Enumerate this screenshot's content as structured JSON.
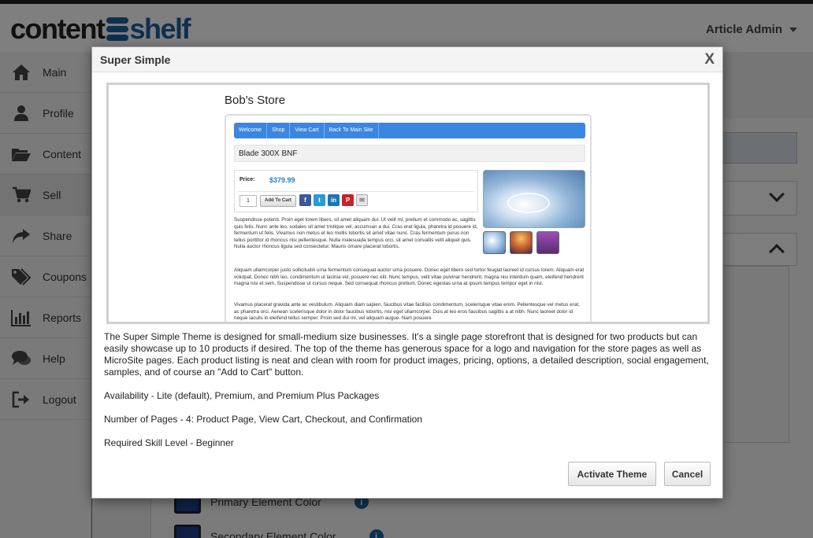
{
  "app": {
    "logo_part1": "content",
    "logo_part2": "shelf",
    "user_menu": "Article Admin"
  },
  "sidebar": {
    "items": [
      {
        "label": "Main",
        "icon": "home-icon"
      },
      {
        "label": "Profile",
        "icon": "user-icon"
      },
      {
        "label": "Content",
        "icon": "folder-icon"
      },
      {
        "label": "Sell",
        "icon": "cart-icon"
      },
      {
        "label": "Share",
        "icon": "share-icon"
      },
      {
        "label": "Coupons",
        "icon": "tags-icon"
      },
      {
        "label": "Reports",
        "icon": "bar-chart-icon"
      },
      {
        "label": "Help",
        "icon": "chat-icon"
      },
      {
        "label": "Logout",
        "icon": "logout-icon"
      }
    ]
  },
  "background": {
    "color_rows": [
      {
        "label": "Primary Element Color"
      },
      {
        "label": "Secondary Element Color"
      }
    ]
  },
  "modal": {
    "title": "Super Simple",
    "close": "X",
    "preview": {
      "store_title": "Bob's Store",
      "nav": [
        "Welcome",
        "Shop",
        "View Cart",
        "Back To Main Site"
      ],
      "product_name": "Blade 300X BNF",
      "price_label": "Price:",
      "price": "$379.99",
      "quantity": "1",
      "add_to_cart": "Add To Cart",
      "social": [
        "f",
        "t",
        "in",
        "P",
        "✉"
      ],
      "paragraphs": [
        "Suspendisse potenti. Proin eget lorem libero, sit amet aliquam dui. Ut velit mi, pretium et commodo ac, sagittis quis felis. Nunc ante leo, sodales sit amet tristique vel, accumsan a dui. Cras erat ligula, pharetra id posuere id, fermentum ut felis. Vivamus non metus et leo mollis lobortis sit amet vitae nunc. Cras fermentum purus non tellus porttitor id rhoncus nisi pellentesque. Nulla malesuada tempus orci, sit amet convallis velit aliquet quis. Nulla auctor rhoncus ligula sed consectetur. Mauris ornare placerat lobortis.",
        "Aliquam ullamcorper justo sollicitudin urna fermentum consequat auctor urna posuere. Donec eget libero sed tortor feugiat laoreet id cursus lorem. Aliquam erat volutpat. Donec nibh leo, condimentum ut lacinia vel, posuere nec elit. Nunc tempus, velit vitae pulvinar hendrerit, magna nisi interdum quam, eleifend hendrerit magna nisi et sem. Suspendisse ut cursus neque. Sed consequat rhoncus pretium. Donec egestas urna at ipsum tempus tempor eget in nisl.",
        "Vivamus placerat gravida ante ac vestibulum. Aliquam diam sapien, faucibus vitae facilisis condimentum, scelerisque vitae enim. Pellentesque vel metus erat, ac pharetra orci. Aenean scelerisque dolor in dolor faucibus lobortis, nisi eget ullamcorper. Duis at leo eros faucibus sagittis a at nibh. Nunc laoreet dolor id neque iaculis in eleifend tellus semper. Proin sed dui mi, vel aliquam augue. Nam posuere"
      ]
    },
    "description": "The Super Simple Theme is designed for small-medium size businesses. It's a single page storefront that is designed for two products but can easily showcase up to 10 products if desired. The top of the theme has generous space for a logo and navigation for the store pages as well as MicroSite pages. Each product listing is neat and clean with room for product images, pricing, options, a detailed description, social engagement, samples, and of course an \"Add to Cart\" button.",
    "availability": "Availability - Lite (default), Premium, and Premium Plus Packages",
    "pages": "Number of Pages - 4: Product Page, View Cart, Checkout, and Confirmation",
    "skill": "Required Skill Level - Beginner",
    "activate_button": "Activate Theme",
    "cancel_button": "Cancel"
  },
  "colors": {
    "brand_blue": "#1f5f9e",
    "nav_blue": "#3a86e0",
    "price_blue": "#2d7ad6"
  }
}
